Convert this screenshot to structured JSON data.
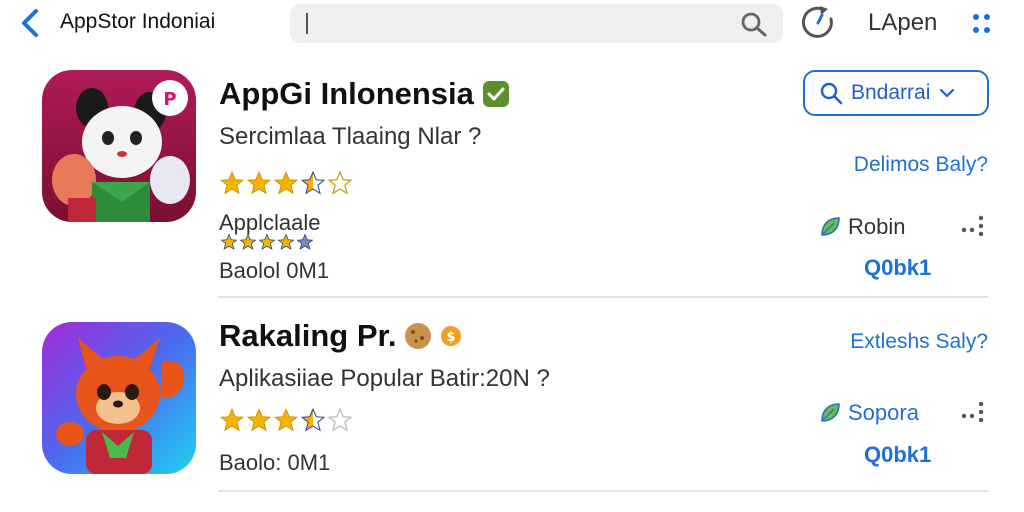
{
  "header": {
    "title": "AppStor Indoniai",
    "search_placeholder": "",
    "user_label": "LApen",
    "accent_color": "#1f6fd8"
  },
  "apps": [
    {
      "name": "AppGi Inlonensia",
      "subtitle": "Sercimlaa Tlaaing Nlar ?",
      "rating": 3.5,
      "availability": "Applclaale",
      "size": "Baolol 0M1",
      "install_label": "Bndarrai",
      "link": "Delimos Baly?",
      "developer": "Robin",
      "code": "Q0bk1",
      "badge_color": "#5b8f2a",
      "icon": "panda-mascot-icon"
    },
    {
      "name": "Rakaling Pr.",
      "subtitle": "Aplikasiiae Popular Batir:20N ?",
      "rating": 3.5,
      "size": "Baolo: 0M1",
      "link": "Extleshs Saly?",
      "developer": "Sopora",
      "code": "Q0bk1",
      "badge_color": "#d88a1f",
      "icon": "fox-mascot-icon"
    }
  ]
}
